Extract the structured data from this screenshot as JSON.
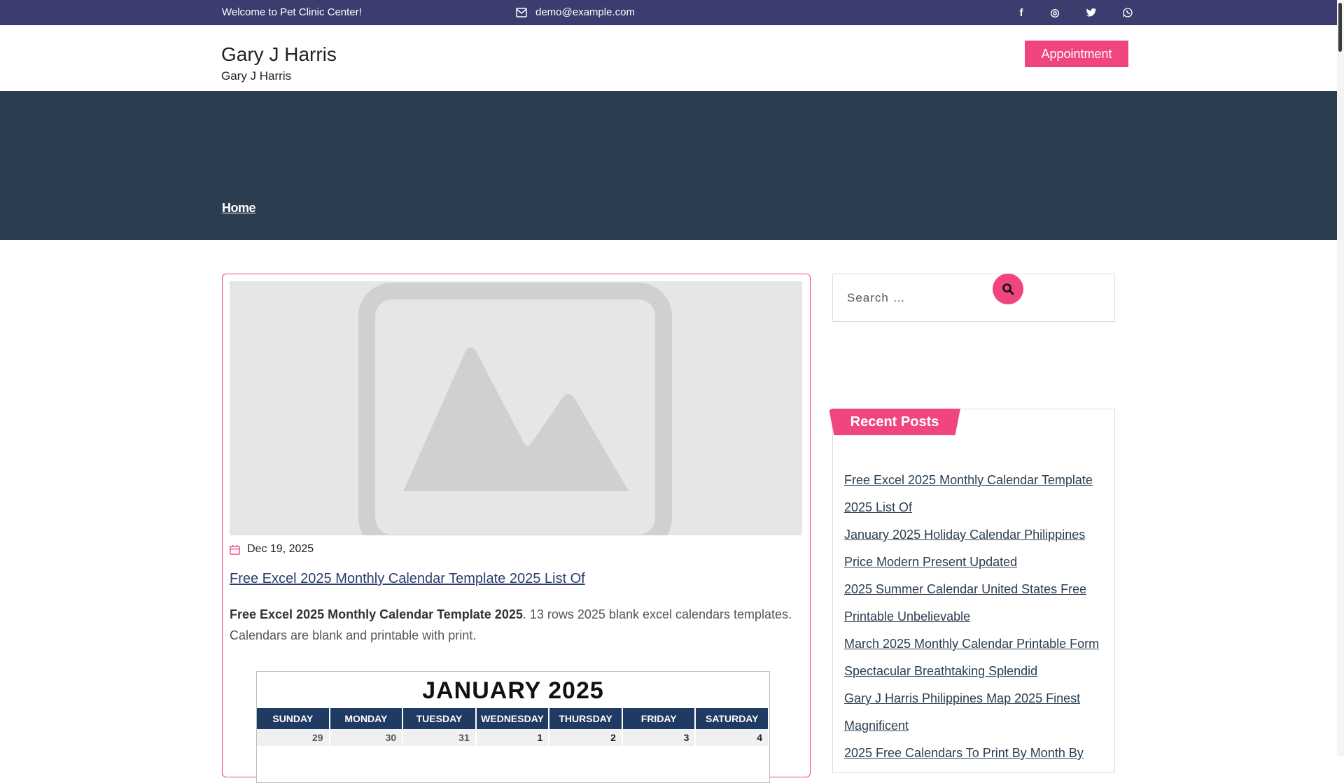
{
  "topbar": {
    "welcome": "Welcome to Pet Clinic Center!",
    "email": "demo@example.com",
    "social": [
      {
        "icon": "facebook-icon",
        "glyph": "f"
      },
      {
        "icon": "instagram-icon",
        "glyph": "◎"
      },
      {
        "icon": "twitter-icon",
        "glyph": "🐦"
      },
      {
        "icon": "whatsapp-icon",
        "glyph": "✆"
      }
    ]
  },
  "header": {
    "title": "Gary J Harris",
    "tagline": "Gary J Harris",
    "appointment_label": "Appointment"
  },
  "hero": {
    "breadcrumb": "Home"
  },
  "post": {
    "date": "Dec 19, 2025",
    "title": "Free Excel 2025 Monthly Calendar Template 2025 List Of",
    "excerpt_bold": "Free Excel 2025 Monthly Calendar Template 2025",
    "excerpt_rest": ". 13 rows 2025 blank excel calendars templates. Calendars are blank and printable with print.",
    "calendar": {
      "title": "JANUARY 2025",
      "days": [
        "SUNDAY",
        "MONDAY",
        "TUESDAY",
        "WEDNESDAY",
        "THURSDAY",
        "FRIDAY",
        "SATURDAY"
      ],
      "first_row": [
        "29",
        "30",
        "31",
        "1",
        "2",
        "3",
        "4"
      ]
    }
  },
  "sidebar": {
    "search_placeholder": "Search …",
    "recent_title": "Recent Posts",
    "recent_posts": [
      "Free Excel 2025 Monthly Calendar Template 2025 List Of",
      "January 2025 Holiday Calendar Philippines Price Modern Present Updated",
      "2025 Summer Calendar United States Free Printable Unbelievable",
      "March 2025 Monthly Calendar Printable Form Spectacular Breathtaking Splendid",
      "Gary J Harris Philippines Map 2025 Finest Magnificent",
      "2025 Free Calendars To Print By Month By"
    ]
  },
  "colors": {
    "topbar": "#3c3d6e",
    "hero": "#2b3d4e",
    "accent": "#f0457e"
  }
}
